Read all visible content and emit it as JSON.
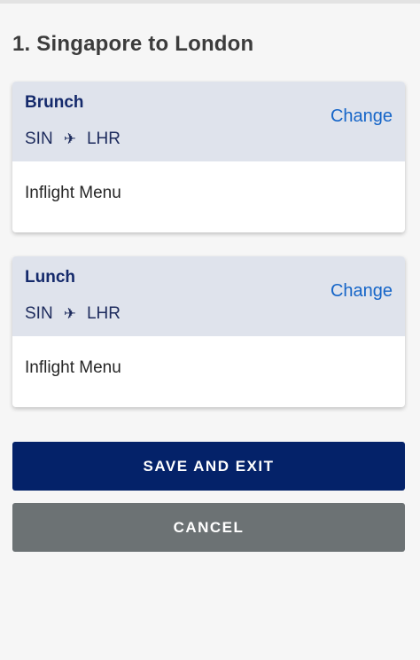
{
  "section": {
    "title": "1. Singapore to London"
  },
  "meals": [
    {
      "name": "Brunch",
      "origin": "SIN",
      "destination": "LHR",
      "change_label": "Change",
      "menu_label": "Inflight Menu"
    },
    {
      "name": "Lunch",
      "origin": "SIN",
      "destination": "LHR",
      "change_label": "Change",
      "menu_label": "Inflight Menu"
    }
  ],
  "actions": {
    "save_label": "SAVE AND EXIT",
    "cancel_label": "CANCEL"
  },
  "icons": {
    "route_separator": "airplane-icon"
  },
  "colors": {
    "primary": "#042269",
    "secondary": "#6c7274",
    "link": "#1565c8",
    "card_header": "#dfe3ec"
  }
}
